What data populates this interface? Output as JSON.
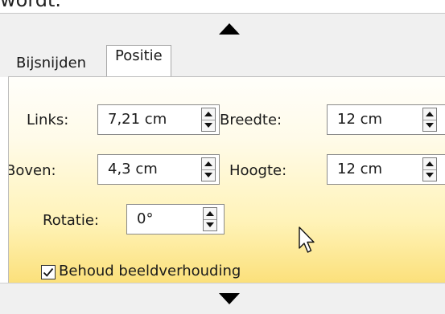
{
  "top_fragment": "wordt.",
  "tabs": [
    {
      "label": "Bijsnijden",
      "active": false
    },
    {
      "label": "Positie",
      "active": true
    }
  ],
  "position": {
    "left": {
      "label": "Links:",
      "value": "7,21 cm"
    },
    "width": {
      "label": "Breedte:",
      "value": "12 cm"
    },
    "top": {
      "label": "Boven:",
      "value": "4,3 cm"
    },
    "height": {
      "label": "Hoogte:",
      "value": "12 cm"
    },
    "rotation": {
      "label": "Rotatie:",
      "value": "0°"
    }
  },
  "lock_aspect": {
    "label": "Behoud beeldverhouding",
    "checked": true
  },
  "icons": {
    "scroll_up": "triangle-up-icon",
    "scroll_down": "triangle-down-icon",
    "cursor": "mouse-pointer-icon",
    "checkmark": "checkmark-icon"
  },
  "colors": {
    "panel_gradient_top": "#fffefa",
    "panel_gradient_bottom": "#fbe07a",
    "chrome": "#f0f0f0"
  }
}
